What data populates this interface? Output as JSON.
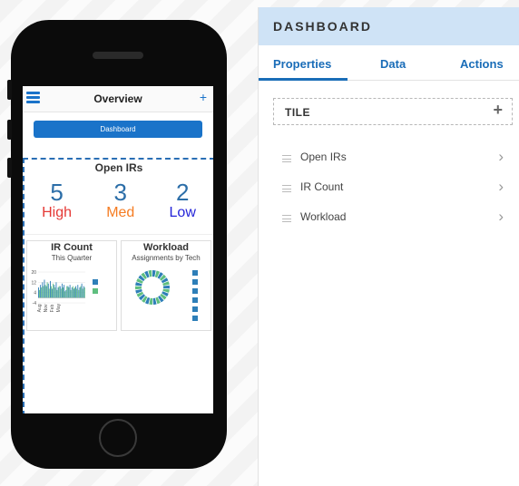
{
  "phone": {
    "title": "Overview",
    "plus": "+",
    "dashboard_button": "Dashboard",
    "open_irs": {
      "title": "Open IRs",
      "counts": [
        {
          "value": "5",
          "label": "High",
          "color": "#e53935"
        },
        {
          "value": "3",
          "label": "Med",
          "color": "#f57c22"
        },
        {
          "value": "2",
          "label": "Low",
          "color": "#2424d8"
        }
      ]
    },
    "ir_count_card": {
      "title": "IR Count",
      "subtitle": "This Quarter"
    },
    "workload_card": {
      "title": "Workload",
      "subtitle": "Assignments by Tech"
    }
  },
  "chart_data": [
    {
      "type": "bar",
      "title": "IR Count",
      "subtitle": "This Quarter",
      "yticks": [
        "20",
        "12",
        "4",
        "-4"
      ],
      "xticks": [
        "Aug",
        "Nov",
        "Feb",
        "May"
      ],
      "ylim": [
        -4,
        20
      ],
      "series": [
        {
          "color": "#2e7fb8",
          "values": [
            8,
            10,
            12,
            14,
            9,
            11,
            13,
            7,
            10,
            12,
            8,
            9,
            11,
            10,
            6,
            9,
            10,
            8,
            7,
            9,
            10,
            8,
            11,
            9
          ]
        },
        {
          "color": "#5fbf7f",
          "values": [
            6,
            8,
            9,
            10,
            12,
            7,
            9,
            11,
            8,
            6,
            9,
            7,
            8,
            5,
            9,
            8,
            6,
            9,
            8,
            7,
            6,
            9,
            7,
            8
          ]
        }
      ]
    },
    {
      "type": "pie",
      "title": "Workload",
      "subtitle": "Assignments by Tech",
      "segments": 26,
      "colors": [
        "#2e7fb8",
        "#5fbf7f"
      ]
    }
  ],
  "panel": {
    "header": "DASHBOARD",
    "tabs": [
      "Properties",
      "Data",
      "Actions"
    ],
    "tile_label": "TILE",
    "tile_plus": "+",
    "items": [
      "Open IRs",
      "IR Count",
      "Workload"
    ],
    "chevron": "›"
  }
}
